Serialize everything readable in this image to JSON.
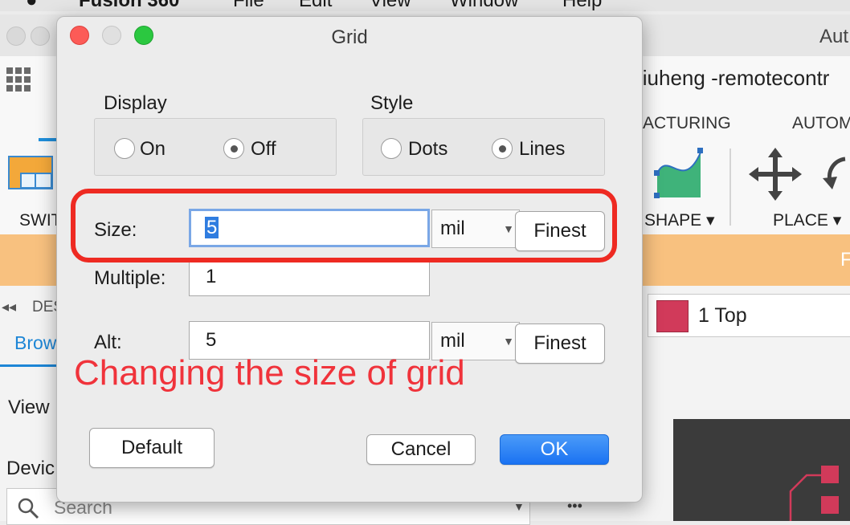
{
  "os_menubar": {
    "app_name": "Fusion 360",
    "menus": [
      "File",
      "Edit",
      "View",
      "Window",
      "Help"
    ]
  },
  "background_app": {
    "title_fragment": "Aut",
    "document_name": "liuheng -remotecontr",
    "toolbar_groups": [
      "ACTURING",
      "AUTOM"
    ],
    "switch_label": "SWIT",
    "tools": [
      "SHAPE",
      "PLACE"
    ],
    "orange_bar_fragment": "F",
    "layer": {
      "color": "#d13a5a",
      "label": "1 Top"
    },
    "panel": {
      "design_tab": "DES",
      "browse_tab": "Brow",
      "view_label": "View",
      "device_label": "Devic",
      "search_placeholder": "Search",
      "more_icon": "•••"
    }
  },
  "dialog": {
    "title": "Grid",
    "display": {
      "label": "Display",
      "options": [
        "On",
        "Off"
      ],
      "selected": "Off"
    },
    "style": {
      "label": "Style",
      "options": [
        "Dots",
        "Lines"
      ],
      "selected": "Lines"
    },
    "size": {
      "label": "Size:",
      "value": "5",
      "unit": "mil",
      "finest_label": "Finest"
    },
    "multiple": {
      "label": "Multiple:",
      "value": "1"
    },
    "alt": {
      "label": "Alt:",
      "value": "5",
      "unit": "mil",
      "finest_label": "Finest"
    },
    "buttons": {
      "default": "Default",
      "cancel": "Cancel",
      "ok": "OK"
    }
  },
  "annotation": {
    "text": "Changing the size of grid",
    "color": "#f0333b"
  },
  "colors": {
    "accent": "#1a72f2",
    "orange_bar": "#f8c17f",
    "close": "#fc5b57",
    "minimize": "#e4e4e4",
    "zoom": "#2bc840"
  }
}
